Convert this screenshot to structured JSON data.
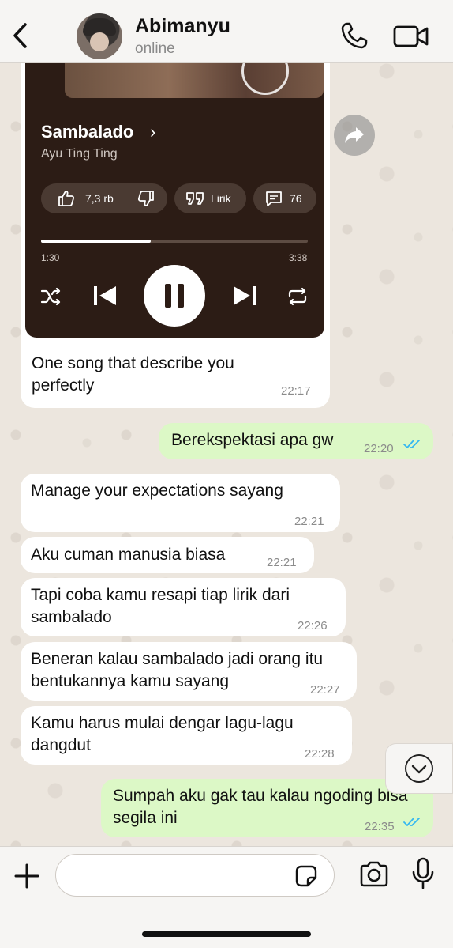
{
  "header": {
    "contact_name": "Abimanyu",
    "status": "online"
  },
  "music_card": {
    "song_title": "Sambalado",
    "title_chevron": "›",
    "artist": "Ayu Ting Ting",
    "likes": "7,3 rb",
    "lyrics_label": "Lirik",
    "comments": "76",
    "time_current": "1:30",
    "time_total": "3:38",
    "progress_fraction": 0.41,
    "caption": "One song that describe you perfectly",
    "caption_time": "22:17"
  },
  "messages": [
    {
      "dir": "out",
      "text": "Berekspektasi apa gw",
      "time": "22:20"
    },
    {
      "dir": "in",
      "text": "Manage your expectations sayang",
      "time": "22:21"
    },
    {
      "dir": "in",
      "text": "Aku cuman manusia biasa",
      "time": "22:21"
    },
    {
      "dir": "in",
      "text": "Tapi coba kamu resapi tiap lirik dari sambalado",
      "time": "22:26"
    },
    {
      "dir": "in",
      "text": "Beneran kalau sambalado jadi orang itu bentukannya kamu sayang",
      "time": "22:27"
    },
    {
      "dir": "in",
      "text": "Kamu harus mulai dengar lagu-lagu dangdut",
      "time": "22:28"
    },
    {
      "dir": "out",
      "text": "Sumpah aku gak tau kalau ngoding bisa segila ini",
      "time": "22:35"
    }
  ],
  "input": {
    "placeholder": ""
  },
  "colors": {
    "outgoing_bubble": "#dcf8c6",
    "incoming_bubble": "#ffffff",
    "read_ticks": "#34b7f1",
    "music_card_bg": "#2c1c15"
  },
  "icons": [
    "back-icon",
    "phone-icon",
    "video-camera-icon",
    "forward-icon",
    "thumbs-up-icon",
    "thumbs-down-icon",
    "quote-icon",
    "comment-icon",
    "shuffle-icon",
    "previous-icon",
    "pause-icon",
    "next-icon",
    "repeat-icon",
    "chevron-down-icon",
    "plus-icon",
    "sticker-icon",
    "camera-icon",
    "microphone-icon"
  ]
}
